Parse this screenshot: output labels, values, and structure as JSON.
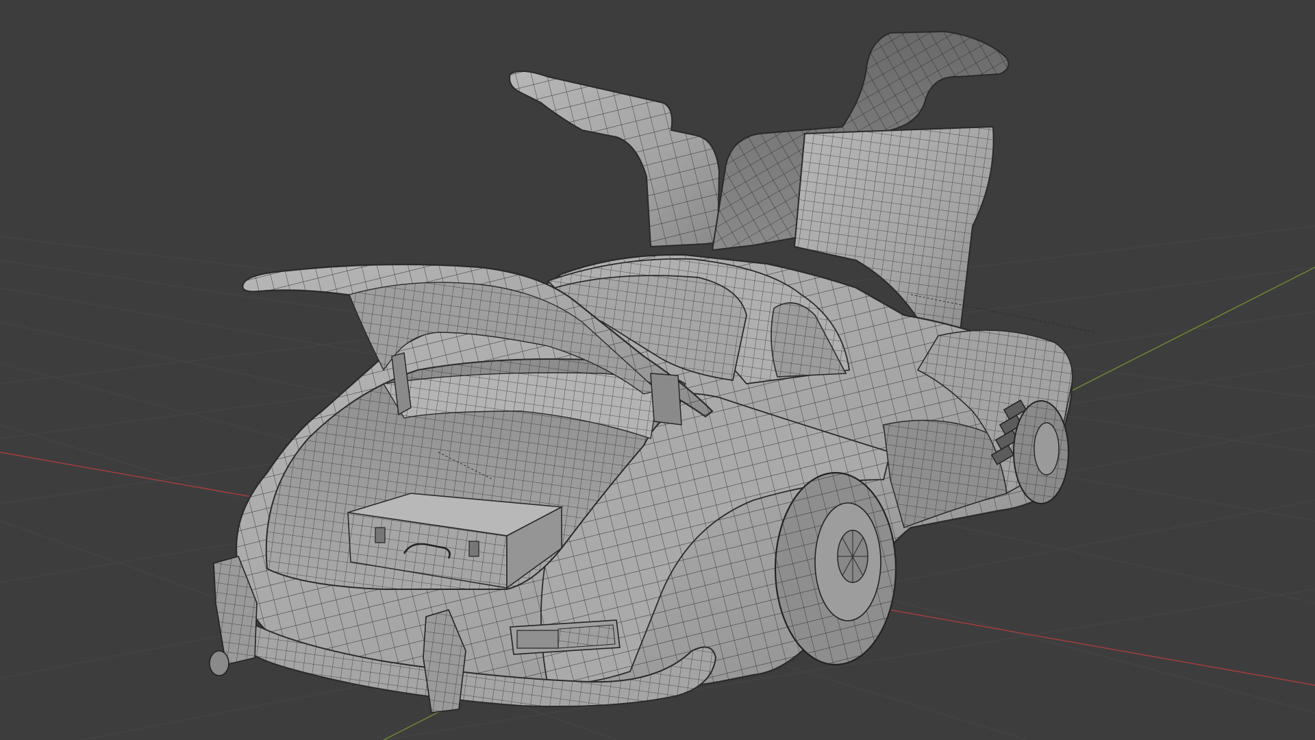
{
  "viewport": {
    "mode": "3d-viewport",
    "shading": "solid-wireframe-overlay",
    "background_color": "#3d3d3d",
    "grid_color": "#4a4a4a",
    "x_axis_color": "#a83d3d",
    "y_axis_color": "#7a9a35"
  },
  "scene": {
    "object": "car",
    "parts": [
      "body",
      "trunk-lid",
      "left-gullwing-door",
      "right-gullwing-door",
      "suitcase",
      "rear-bumper",
      "rear-wheel",
      "front-wheel",
      "tail-light",
      "side-vents"
    ]
  }
}
